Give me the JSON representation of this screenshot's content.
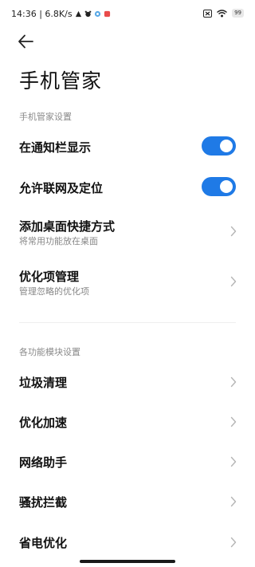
{
  "status_bar": {
    "time_speed": "14:36 | 6.8K/s",
    "battery": "99",
    "colors": {
      "text": "#222222"
    }
  },
  "header": {
    "back_icon": "arrow-left-icon",
    "title": "手机管家"
  },
  "section_manager": {
    "header": "手机管家设置",
    "rows": [
      {
        "label": "在通知栏显示",
        "toggle": "on"
      },
      {
        "label": "允许联网及定位",
        "toggle": "on"
      },
      {
        "label": "添加桌面快捷方式",
        "sub": "将常用功能放在桌面"
      },
      {
        "label": "优化项管理",
        "sub": "管理忽略的优化项"
      }
    ]
  },
  "section_modules": {
    "header": "各功能模块设置",
    "rows": [
      {
        "label": "垃圾清理"
      },
      {
        "label": "优化加速"
      },
      {
        "label": "网络助手"
      },
      {
        "label": "骚扰拦截"
      },
      {
        "label": "省电优化"
      }
    ]
  },
  "colors": {
    "accent": "#1f7ae6",
    "secondary_text": "#888888"
  }
}
